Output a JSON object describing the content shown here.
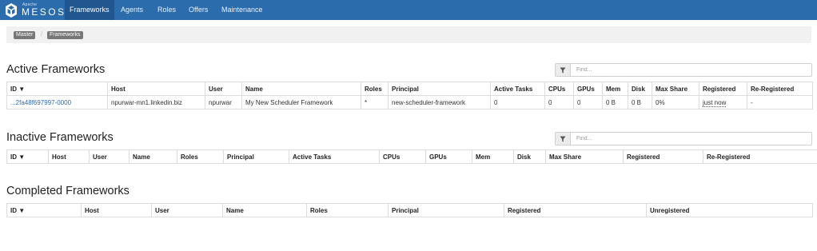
{
  "navbar": {
    "brand_top": "Apache",
    "brand_name": "MESOS",
    "items": [
      {
        "label": "Frameworks",
        "active": true
      },
      {
        "label": "Agents",
        "active": false
      },
      {
        "label": "Roles",
        "active": false
      },
      {
        "label": "Offers",
        "active": false
      },
      {
        "label": "Maintenance",
        "active": false
      }
    ]
  },
  "breadcrumb": [
    "Master",
    "Frameworks"
  ],
  "breadcrumb_separator": "/",
  "active": {
    "title": "Active Frameworks",
    "filter_placeholder": "Find...",
    "columns": [
      "ID ▼",
      "Host",
      "User",
      "Name",
      "Roles",
      "Principal",
      "Active Tasks",
      "CPUs",
      "GPUs",
      "Mem",
      "Disk",
      "Max Share",
      "Registered",
      "Re-Registered"
    ],
    "rows": [
      {
        "id": "...2fa48f697997-0000",
        "host": "npurwar-mn1.linkedin.biz",
        "user": "npurwar",
        "name": "My New Scheduler Framework",
        "roles": "*",
        "principal": "new-scheduler-framework",
        "active_tasks": "0",
        "cpus": "0",
        "gpus": "0",
        "mem": "0 B",
        "disk": "0 B",
        "max_share": "0%",
        "registered": "just now",
        "reregistered": "-"
      }
    ]
  },
  "inactive": {
    "title": "Inactive Frameworks",
    "filter_placeholder": "Find...",
    "columns": [
      "ID ▼",
      "Host",
      "User",
      "Name",
      "Roles",
      "Principal",
      "Active Tasks",
      "CPUs",
      "GPUs",
      "Mem",
      "Disk",
      "Max Share",
      "Registered",
      "Re-Registered"
    ]
  },
  "completed": {
    "title": "Completed Frameworks",
    "columns": [
      "ID ▼",
      "Host",
      "User",
      "Name",
      "Roles",
      "Principal",
      "Registered",
      "Unregistered"
    ]
  },
  "colors": {
    "navbar": "#2b6cad",
    "nav_active": "#20578f",
    "link": "#2b6cad",
    "crumb": "#777777"
  }
}
